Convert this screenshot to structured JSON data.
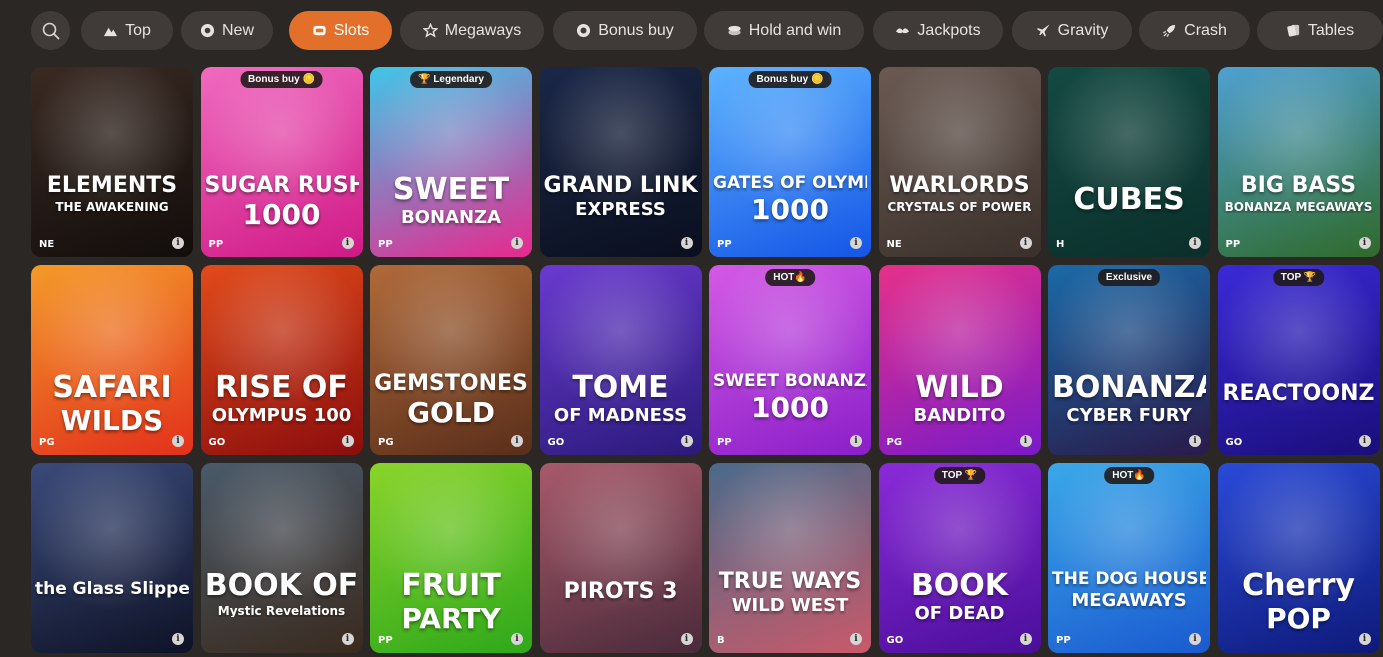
{
  "search": {
    "icon": "search-icon"
  },
  "tabs": [
    {
      "label": "Top",
      "icon": "mountain-icon",
      "active": false
    },
    {
      "label": "New",
      "icon": "gear-badge-icon",
      "active": false
    },
    {
      "label": "Slots",
      "icon": "slot-machine-icon",
      "active": true
    },
    {
      "label": "Megaways",
      "icon": "star-outline-icon",
      "active": false
    },
    {
      "label": "Bonus buy",
      "icon": "coin-icon",
      "active": false
    },
    {
      "label": "Hold and win",
      "icon": "coins-stack-icon",
      "active": false
    },
    {
      "label": "Jackpots",
      "icon": "money-wings-icon",
      "active": false
    },
    {
      "label": "Gravity",
      "icon": "plane-icon",
      "active": false
    },
    {
      "label": "Crash",
      "icon": "rocket-icon",
      "active": false
    },
    {
      "label": "Tables",
      "icon": "cards-icon",
      "active": false
    }
  ],
  "games": [
    {
      "line1": "ELEMENTS",
      "line2": "THE AWAKENING",
      "badge": "",
      "provider": "NE",
      "colors": [
        "#3a2a22",
        "#120d0b"
      ]
    },
    {
      "line1": "SUGAR RUSH",
      "line2": "1000",
      "badge": "Bonus buy 🪙",
      "provider": "PP",
      "colors": [
        "#f06ac0",
        "#d01a86"
      ]
    },
    {
      "line1": "SWEET",
      "line2": "BONANZA",
      "badge": "🏆 Legendary",
      "provider": "PP",
      "colors": [
        "#3fc6e8",
        "#e8288e"
      ]
    },
    {
      "line1": "GRAND LINK",
      "line2": "EXPRESS",
      "badge": "",
      "provider": "",
      "colors": [
        "#1a2748",
        "#0a0f1e"
      ]
    },
    {
      "line1": "GATES OF OLYMPUS",
      "line2": "1000",
      "badge": "Bonus buy 🪙",
      "provider": "PP",
      "colors": [
        "#5cb3ff",
        "#1555e6"
      ]
    },
    {
      "line1": "WARLORDS",
      "line2": "CRYSTALS OF POWER",
      "badge": "",
      "provider": "NE",
      "colors": [
        "#6a5a52",
        "#3b302b"
      ]
    },
    {
      "line1": "CUBES",
      "line2": "",
      "badge": "",
      "provider": "H",
      "colors": [
        "#134a42",
        "#0b2f2b"
      ]
    },
    {
      "line1": "BIG BASS",
      "line2": "BONANZA MEGAWAYS",
      "badge": "",
      "provider": "PP",
      "colors": [
        "#4fa0d2",
        "#2f6a2a"
      ]
    },
    {
      "line1": "SAFARI",
      "line2": "WILDS",
      "badge": "",
      "provider": "PG",
      "colors": [
        "#f49a28",
        "#e2301c"
      ]
    },
    {
      "line1": "RISE OF",
      "line2": "OLYMPUS 100",
      "badge": "",
      "provider": "GO",
      "colors": [
        "#e24a1a",
        "#8a0d0d"
      ]
    },
    {
      "line1": "GEMSTONES",
      "line2": "GOLD",
      "badge": "",
      "provider": "PG",
      "colors": [
        "#b06a3a",
        "#5a2e1a"
      ]
    },
    {
      "line1": "TOME",
      "line2": "OF MADNESS",
      "badge": "",
      "provider": "GO",
      "colors": [
        "#6a3ad0",
        "#2a1a7a"
      ]
    },
    {
      "line1": "SWEET BONANZA",
      "line2": "1000",
      "badge": "HOT🔥",
      "provider": "PP",
      "colors": [
        "#d45ae6",
        "#8a1ec8"
      ]
    },
    {
      "line1": "WILD",
      "line2": "BANDITO",
      "badge": "",
      "provider": "PG",
      "colors": [
        "#e6308a",
        "#7a1ac8"
      ]
    },
    {
      "line1": "BONANZA",
      "line2": "CYBER FURY",
      "badge": "Exclusive",
      "provider": "",
      "colors": [
        "#1a6aa8",
        "#2a1a4a"
      ]
    },
    {
      "line1": "REACTOONZ",
      "line2": "",
      "badge": "TOP 🏆",
      "provider": "GO",
      "colors": [
        "#3a2ad8",
        "#1a0e7a"
      ]
    },
    {
      "line1": "the Glass Slipper",
      "line2": "",
      "badge": "",
      "provider": "",
      "colors": [
        "#3a4a7a",
        "#0e1226"
      ]
    },
    {
      "line1": "BOOK OF",
      "line2": "Mystic Revelations",
      "badge": "",
      "provider": "",
      "colors": [
        "#4a5a6a",
        "#3a2a1e"
      ]
    },
    {
      "line1": "FRUIT",
      "line2": "PARTY",
      "badge": "",
      "provider": "PP",
      "colors": [
        "#8ad42a",
        "#2ea81a"
      ]
    },
    {
      "line1": "PIROTS 3",
      "line2": "",
      "badge": "",
      "provider": "",
      "colors": [
        "#a85a6a",
        "#4a2a3a"
      ]
    },
    {
      "line1": "TRUE WAYS",
      "line2": "WILD WEST",
      "badge": "",
      "provider": "B",
      "colors": [
        "#4a6a8a",
        "#c85a6a"
      ]
    },
    {
      "line1": "BOOK",
      "line2": "OF DEAD",
      "badge": "TOP 🏆",
      "provider": "GO",
      "colors": [
        "#8a2ad8",
        "#4a0e9a"
      ]
    },
    {
      "line1": "THE DOG HOUSE",
      "line2": "MEGAWAYS",
      "badge": "HOT🔥",
      "provider": "PP",
      "colors": [
        "#3aa8e8",
        "#1a5ad0"
      ]
    },
    {
      "line1": "Cherry",
      "line2": "POP",
      "badge": "",
      "provider": "",
      "colors": [
        "#2a4ad8",
        "#0e1a7a"
      ]
    }
  ]
}
